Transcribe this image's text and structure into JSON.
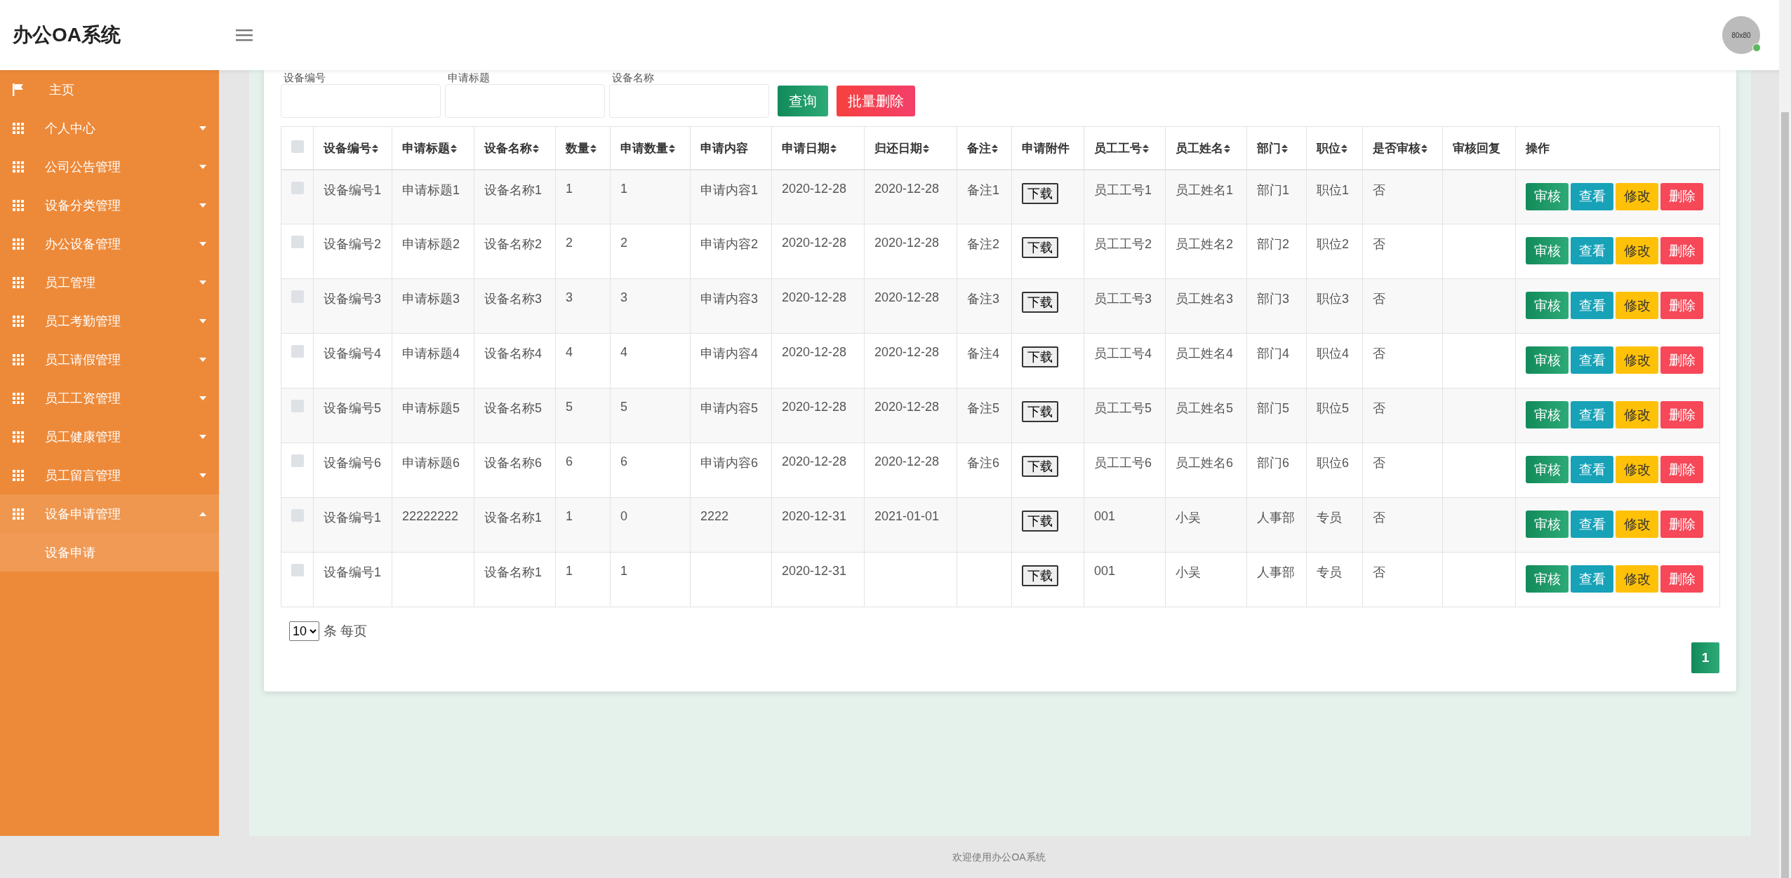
{
  "app_title": "办公OA系统",
  "avatar": {
    "label": "80x80",
    "online": true
  },
  "sidebar": {
    "items": [
      {
        "label": "主页",
        "kind": "link"
      },
      {
        "label": "个人中心",
        "kind": "group",
        "expanded": false
      },
      {
        "label": "公司公告管理",
        "kind": "group",
        "expanded": false
      },
      {
        "label": "设备分类管理",
        "kind": "group",
        "expanded": false
      },
      {
        "label": "办公设备管理",
        "kind": "group",
        "expanded": false
      },
      {
        "label": "员工管理",
        "kind": "group",
        "expanded": false
      },
      {
        "label": "员工考勤管理",
        "kind": "group",
        "expanded": false
      },
      {
        "label": "员工请假管理",
        "kind": "group",
        "expanded": false
      },
      {
        "label": "员工工资管理",
        "kind": "group",
        "expanded": false
      },
      {
        "label": "员工健康管理",
        "kind": "group",
        "expanded": false
      },
      {
        "label": "员工留言管理",
        "kind": "group",
        "expanded": false
      },
      {
        "label": "设备申请管理",
        "kind": "group",
        "expanded": true,
        "children": [
          {
            "label": "设备申请",
            "selected": true
          }
        ]
      }
    ]
  },
  "search": {
    "fields": [
      {
        "label": "设备编号"
      },
      {
        "label": "申请标题"
      },
      {
        "label": "设备名称"
      }
    ],
    "buttons": [
      {
        "label": "查询",
        "kind": "primary"
      },
      {
        "label": "批量删除",
        "kind": "danger"
      }
    ]
  },
  "table": {
    "select_all_checked": false,
    "columns": [
      {
        "label": "设备编号",
        "sortable": true,
        "kind": "data"
      },
      {
        "label": "申请标题",
        "sortable": true,
        "kind": "data"
      },
      {
        "label": "设备名称",
        "sortable": true,
        "kind": "data"
      },
      {
        "label": "数量",
        "sortable": true,
        "kind": "data"
      },
      {
        "label": "申请数量",
        "sortable": true,
        "kind": "data"
      },
      {
        "label": "申请内容",
        "sortable": false,
        "kind": "data"
      },
      {
        "label": "申请日期",
        "sortable": true,
        "kind": "data"
      },
      {
        "label": "归还日期",
        "sortable": true,
        "kind": "data"
      },
      {
        "label": "备注",
        "sortable": true,
        "kind": "data"
      },
      {
        "label": "申请附件",
        "sortable": false,
        "kind": "data"
      },
      {
        "label": "员工工号",
        "sortable": true,
        "kind": "data"
      },
      {
        "label": "员工姓名",
        "sortable": true,
        "kind": "data"
      },
      {
        "label": "部门",
        "sortable": true,
        "kind": "data"
      },
      {
        "label": "职位",
        "sortable": true,
        "kind": "data"
      },
      {
        "label": "是否审核",
        "sortable": true,
        "kind": "data"
      },
      {
        "label": "审核回复",
        "sortable": false,
        "kind": "data"
      },
      {
        "label": "操作",
        "sortable": false,
        "kind": "actions"
      }
    ],
    "rows": [
      {
        "checked": false,
        "cells": [
          {
            "kind": "text",
            "text": "设备编号1"
          },
          {
            "kind": "text",
            "text": "申请标题1"
          },
          {
            "kind": "text",
            "text": "设备名称1"
          },
          {
            "kind": "text",
            "text": "1"
          },
          {
            "kind": "text",
            "text": "1"
          },
          {
            "kind": "text",
            "text": "申请内容1"
          },
          {
            "kind": "text",
            "text": "2020-12-28"
          },
          {
            "kind": "text",
            "text": "2020-12-28"
          },
          {
            "kind": "text",
            "text": "备注1"
          },
          {
            "kind": "file",
            "text": "下载"
          },
          {
            "kind": "text",
            "text": "员工工号1"
          },
          {
            "kind": "text",
            "text": "员工姓名1"
          },
          {
            "kind": "text",
            "text": "部门1"
          },
          {
            "kind": "text",
            "text": "职位1"
          },
          {
            "kind": "text",
            "text": "否"
          },
          {
            "kind": "empty"
          }
        ],
        "actions": [
          {
            "label": "审核",
            "kind": "review"
          },
          {
            "label": "查看",
            "kind": "view"
          },
          {
            "label": "修改",
            "kind": "edit"
          },
          {
            "label": "删除",
            "kind": "delete"
          }
        ]
      },
      {
        "checked": false,
        "cells": [
          {
            "kind": "text",
            "text": "设备编号2"
          },
          {
            "kind": "text",
            "text": "申请标题2"
          },
          {
            "kind": "text",
            "text": "设备名称2"
          },
          {
            "kind": "text",
            "text": "2"
          },
          {
            "kind": "text",
            "text": "2"
          },
          {
            "kind": "text",
            "text": "申请内容2"
          },
          {
            "kind": "text",
            "text": "2020-12-28"
          },
          {
            "kind": "text",
            "text": "2020-12-28"
          },
          {
            "kind": "text",
            "text": "备注2"
          },
          {
            "kind": "file",
            "text": "下载"
          },
          {
            "kind": "text",
            "text": "员工工号2"
          },
          {
            "kind": "text",
            "text": "员工姓名2"
          },
          {
            "kind": "text",
            "text": "部门2"
          },
          {
            "kind": "text",
            "text": "职位2"
          },
          {
            "kind": "text",
            "text": "否"
          },
          {
            "kind": "empty"
          }
        ],
        "actions": [
          {
            "label": "审核",
            "kind": "review"
          },
          {
            "label": "查看",
            "kind": "view"
          },
          {
            "label": "修改",
            "kind": "edit"
          },
          {
            "label": "删除",
            "kind": "delete"
          }
        ]
      },
      {
        "checked": false,
        "cells": [
          {
            "kind": "text",
            "text": "设备编号3"
          },
          {
            "kind": "text",
            "text": "申请标题3"
          },
          {
            "kind": "text",
            "text": "设备名称3"
          },
          {
            "kind": "text",
            "text": "3"
          },
          {
            "kind": "text",
            "text": "3"
          },
          {
            "kind": "text",
            "text": "申请内容3"
          },
          {
            "kind": "text",
            "text": "2020-12-28"
          },
          {
            "kind": "text",
            "text": "2020-12-28"
          },
          {
            "kind": "text",
            "text": "备注3"
          },
          {
            "kind": "file",
            "text": "下载"
          },
          {
            "kind": "text",
            "text": "员工工号3"
          },
          {
            "kind": "text",
            "text": "员工姓名3"
          },
          {
            "kind": "text",
            "text": "部门3"
          },
          {
            "kind": "text",
            "text": "职位3"
          },
          {
            "kind": "text",
            "text": "否"
          },
          {
            "kind": "empty"
          }
        ],
        "actions": [
          {
            "label": "审核",
            "kind": "review"
          },
          {
            "label": "查看",
            "kind": "view"
          },
          {
            "label": "修改",
            "kind": "edit"
          },
          {
            "label": "删除",
            "kind": "delete"
          }
        ]
      },
      {
        "checked": false,
        "cells": [
          {
            "kind": "text",
            "text": "设备编号4"
          },
          {
            "kind": "text",
            "text": "申请标题4"
          },
          {
            "kind": "text",
            "text": "设备名称4"
          },
          {
            "kind": "text",
            "text": "4"
          },
          {
            "kind": "text",
            "text": "4"
          },
          {
            "kind": "text",
            "text": "申请内容4"
          },
          {
            "kind": "text",
            "text": "2020-12-28"
          },
          {
            "kind": "text",
            "text": "2020-12-28"
          },
          {
            "kind": "text",
            "text": "备注4"
          },
          {
            "kind": "file",
            "text": "下载"
          },
          {
            "kind": "text",
            "text": "员工工号4"
          },
          {
            "kind": "text",
            "text": "员工姓名4"
          },
          {
            "kind": "text",
            "text": "部门4"
          },
          {
            "kind": "text",
            "text": "职位4"
          },
          {
            "kind": "text",
            "text": "否"
          },
          {
            "kind": "empty"
          }
        ],
        "actions": [
          {
            "label": "审核",
            "kind": "review"
          },
          {
            "label": "查看",
            "kind": "view"
          },
          {
            "label": "修改",
            "kind": "edit"
          },
          {
            "label": "删除",
            "kind": "delete"
          }
        ]
      },
      {
        "checked": false,
        "cells": [
          {
            "kind": "text",
            "text": "设备编号5"
          },
          {
            "kind": "text",
            "text": "申请标题5"
          },
          {
            "kind": "text",
            "text": "设备名称5"
          },
          {
            "kind": "text",
            "text": "5"
          },
          {
            "kind": "text",
            "text": "5"
          },
          {
            "kind": "text",
            "text": "申请内容5"
          },
          {
            "kind": "text",
            "text": "2020-12-28"
          },
          {
            "kind": "text",
            "text": "2020-12-28"
          },
          {
            "kind": "text",
            "text": "备注5"
          },
          {
            "kind": "file",
            "text": "下载"
          },
          {
            "kind": "text",
            "text": "员工工号5"
          },
          {
            "kind": "text",
            "text": "员工姓名5"
          },
          {
            "kind": "text",
            "text": "部门5"
          },
          {
            "kind": "text",
            "text": "职位5"
          },
          {
            "kind": "text",
            "text": "否"
          },
          {
            "kind": "empty"
          }
        ],
        "actions": [
          {
            "label": "审核",
            "kind": "review"
          },
          {
            "label": "查看",
            "kind": "view"
          },
          {
            "label": "修改",
            "kind": "edit"
          },
          {
            "label": "删除",
            "kind": "delete"
          }
        ]
      },
      {
        "checked": false,
        "cells": [
          {
            "kind": "text",
            "text": "设备编号6"
          },
          {
            "kind": "text",
            "text": "申请标题6"
          },
          {
            "kind": "text",
            "text": "设备名称6"
          },
          {
            "kind": "text",
            "text": "6"
          },
          {
            "kind": "text",
            "text": "6"
          },
          {
            "kind": "text",
            "text": "申请内容6"
          },
          {
            "kind": "text",
            "text": "2020-12-28"
          },
          {
            "kind": "text",
            "text": "2020-12-28"
          },
          {
            "kind": "text",
            "text": "备注6"
          },
          {
            "kind": "file",
            "text": "下载"
          },
          {
            "kind": "text",
            "text": "员工工号6"
          },
          {
            "kind": "text",
            "text": "员工姓名6"
          },
          {
            "kind": "text",
            "text": "部门6"
          },
          {
            "kind": "text",
            "text": "职位6"
          },
          {
            "kind": "text",
            "text": "否"
          },
          {
            "kind": "empty"
          }
        ],
        "actions": [
          {
            "label": "审核",
            "kind": "review"
          },
          {
            "label": "查看",
            "kind": "view"
          },
          {
            "label": "修改",
            "kind": "edit"
          },
          {
            "label": "删除",
            "kind": "delete"
          }
        ]
      },
      {
        "checked": false,
        "cells": [
          {
            "kind": "text",
            "text": "设备编号1"
          },
          {
            "kind": "text",
            "text": "22222222"
          },
          {
            "kind": "text",
            "text": "设备名称1"
          },
          {
            "kind": "text",
            "text": "1"
          },
          {
            "kind": "text",
            "text": "0"
          },
          {
            "kind": "text",
            "text": "2222"
          },
          {
            "kind": "text",
            "text": "2020-12-31"
          },
          {
            "kind": "text",
            "text": "2021-01-01"
          },
          {
            "kind": "empty"
          },
          {
            "kind": "file",
            "text": "下载"
          },
          {
            "kind": "text",
            "text": "001"
          },
          {
            "kind": "text",
            "text": "小吴"
          },
          {
            "kind": "text",
            "text": "人事部"
          },
          {
            "kind": "text",
            "text": "专员"
          },
          {
            "kind": "text",
            "text": "否"
          },
          {
            "kind": "empty"
          }
        ],
        "actions": [
          {
            "label": "审核",
            "kind": "review"
          },
          {
            "label": "查看",
            "kind": "view"
          },
          {
            "label": "修改",
            "kind": "edit"
          },
          {
            "label": "删除",
            "kind": "delete"
          }
        ]
      },
      {
        "checked": false,
        "cells": [
          {
            "kind": "text",
            "text": "设备编号1"
          },
          {
            "kind": "empty"
          },
          {
            "kind": "text",
            "text": "设备名称1"
          },
          {
            "kind": "text",
            "text": "1"
          },
          {
            "kind": "text",
            "text": "1"
          },
          {
            "kind": "empty"
          },
          {
            "kind": "text",
            "text": "2020-12-31"
          },
          {
            "kind": "empty"
          },
          {
            "kind": "empty"
          },
          {
            "kind": "file",
            "text": "下载"
          },
          {
            "kind": "text",
            "text": "001"
          },
          {
            "kind": "text",
            "text": "小吴"
          },
          {
            "kind": "text",
            "text": "人事部"
          },
          {
            "kind": "text",
            "text": "专员"
          },
          {
            "kind": "text",
            "text": "否"
          },
          {
            "kind": "empty"
          }
        ],
        "actions": [
          {
            "label": "审核",
            "kind": "review"
          },
          {
            "label": "查看",
            "kind": "view"
          },
          {
            "label": "修改",
            "kind": "edit"
          },
          {
            "label": "删除",
            "kind": "delete"
          }
        ]
      }
    ]
  },
  "pagination": {
    "page_size": "10",
    "per_page_label": "条 每页",
    "pages": [
      {
        "label": "1",
        "selected": true
      }
    ]
  },
  "footer": "欢迎使用办公OA系统"
}
